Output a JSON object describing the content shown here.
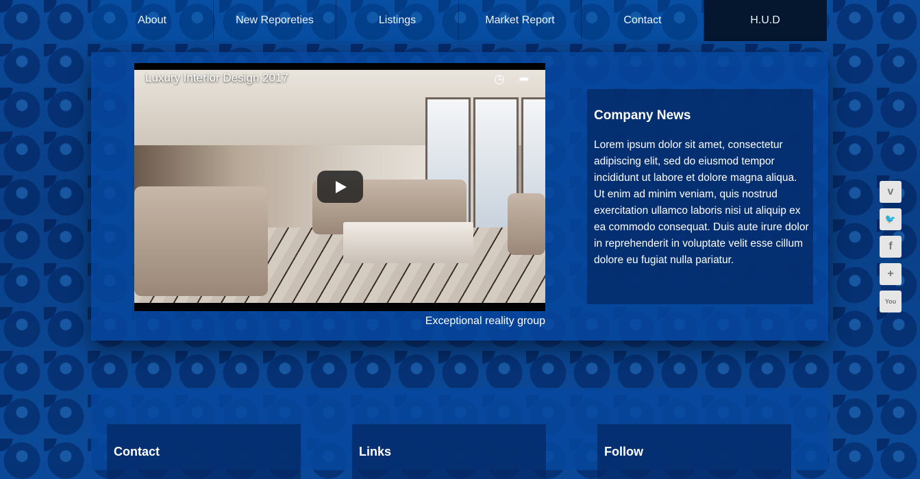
{
  "nav": {
    "items": [
      {
        "label": "About"
      },
      {
        "label": "New Reporeties"
      },
      {
        "label": "Listings"
      },
      {
        "label": "Market Report"
      },
      {
        "label": "Contact"
      },
      {
        "label": "H.U.D"
      }
    ]
  },
  "video": {
    "title": "Luxury Interior Design 2017",
    "caption": "Exceptional reality group",
    "icons": [
      "clock-icon",
      "share-icon",
      "play-icon"
    ]
  },
  "news": {
    "heading": "Company News",
    "body": "Lorem ipsum dolor sit amet, consectetur adipiscing elit, sed do eiusmod tempor incididunt ut labore et dolore magna aliqua. Ut enim ad minim veniam, quis nostrud exercitation ullamco laboris nisi ut aliquip ex ea commodo consequat. Duis aute irure dolor in reprehenderit in voluptate velit esse cillum dolore eu fugiat nulla pariatur."
  },
  "social": {
    "icons": [
      "vimeo-icon",
      "twitter-icon",
      "facebook-icon",
      "plus-icon",
      "youtube-icon"
    ],
    "glyphs": [
      "v",
      "🐦",
      "f",
      "+",
      "You"
    ]
  },
  "footer": {
    "columns": [
      {
        "heading": "Contact"
      },
      {
        "heading": "Links"
      },
      {
        "heading": "Follow"
      }
    ]
  }
}
